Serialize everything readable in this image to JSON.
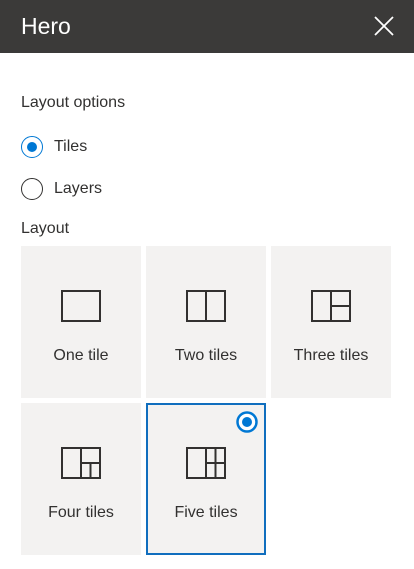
{
  "panel": {
    "title": "Hero",
    "close_icon": "close-icon"
  },
  "layout_options": {
    "label": "Layout options",
    "options": [
      {
        "label": "Tiles",
        "selected": true
      },
      {
        "label": "Layers",
        "selected": false
      }
    ]
  },
  "layout": {
    "label": "Layout",
    "tiles": [
      {
        "label": "One tile",
        "icon": "one-tile-icon",
        "selected": false
      },
      {
        "label": "Two tiles",
        "icon": "two-tiles-icon",
        "selected": false
      },
      {
        "label": "Three tiles",
        "icon": "three-tiles-icon",
        "selected": false
      },
      {
        "label": "Four tiles",
        "icon": "four-tiles-icon",
        "selected": false
      },
      {
        "label": "Five tiles",
        "icon": "five-tiles-icon",
        "selected": true
      }
    ]
  },
  "colors": {
    "header_bg": "#3b3a39",
    "accent": "#0078d4",
    "tile_bg": "#f3f2f1",
    "selected_border": "#106ebe"
  }
}
